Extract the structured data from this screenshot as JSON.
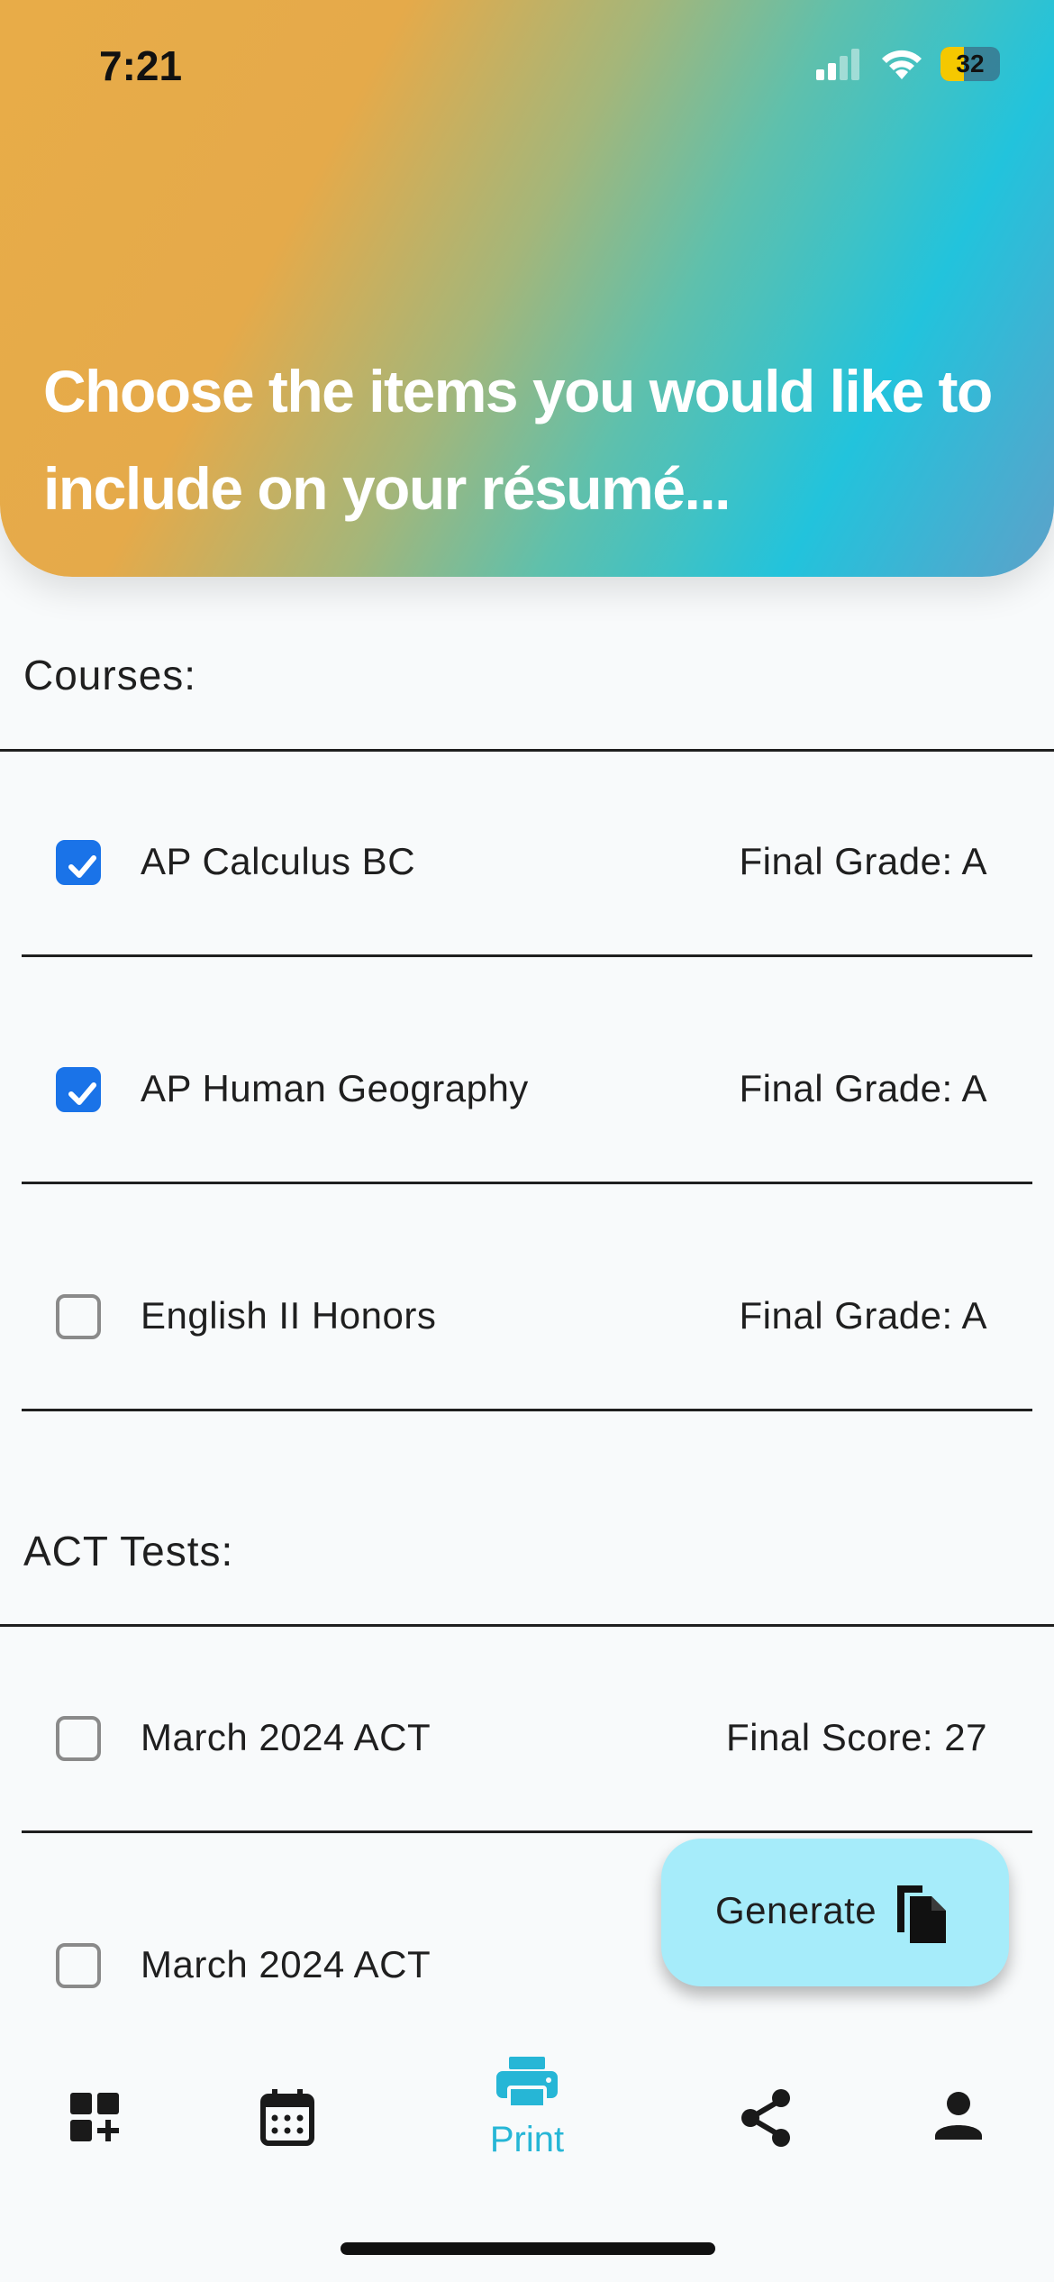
{
  "status_bar": {
    "time": "7:21",
    "battery": "32"
  },
  "header": {
    "title": "Choose the items you would like to include on your résumé..."
  },
  "courses": {
    "label": "Courses:",
    "items": [
      {
        "name": "AP Calculus BC",
        "value": "Final Grade: A",
        "checked": true
      },
      {
        "name": "AP Human Geography",
        "value": "Final Grade: A",
        "checked": true
      },
      {
        "name": "English II Honors",
        "value": "Final Grade: A",
        "checked": false
      }
    ]
  },
  "act_tests": {
    "label": "ACT Tests:",
    "items": [
      {
        "name": "March 2024 ACT",
        "value": "Final Score: 27",
        "checked": false
      },
      {
        "name": "March 2024 ACT",
        "value": "",
        "checked": false
      }
    ]
  },
  "fab": {
    "label": "Generate",
    "icon": "copy-document-icon"
  },
  "bottom_nav": {
    "items": [
      {
        "icon": "dashboard-add-icon",
        "label": ""
      },
      {
        "icon": "calendar-icon",
        "label": ""
      },
      {
        "icon": "printer-icon",
        "label": "Print",
        "active": true
      },
      {
        "icon": "share-icon",
        "label": ""
      },
      {
        "icon": "person-icon",
        "label": ""
      }
    ],
    "active_color": "#26b6d6"
  },
  "colors": {
    "checkbox_checked": "#1a73e8",
    "fab_bg": "#a6ecfa"
  }
}
